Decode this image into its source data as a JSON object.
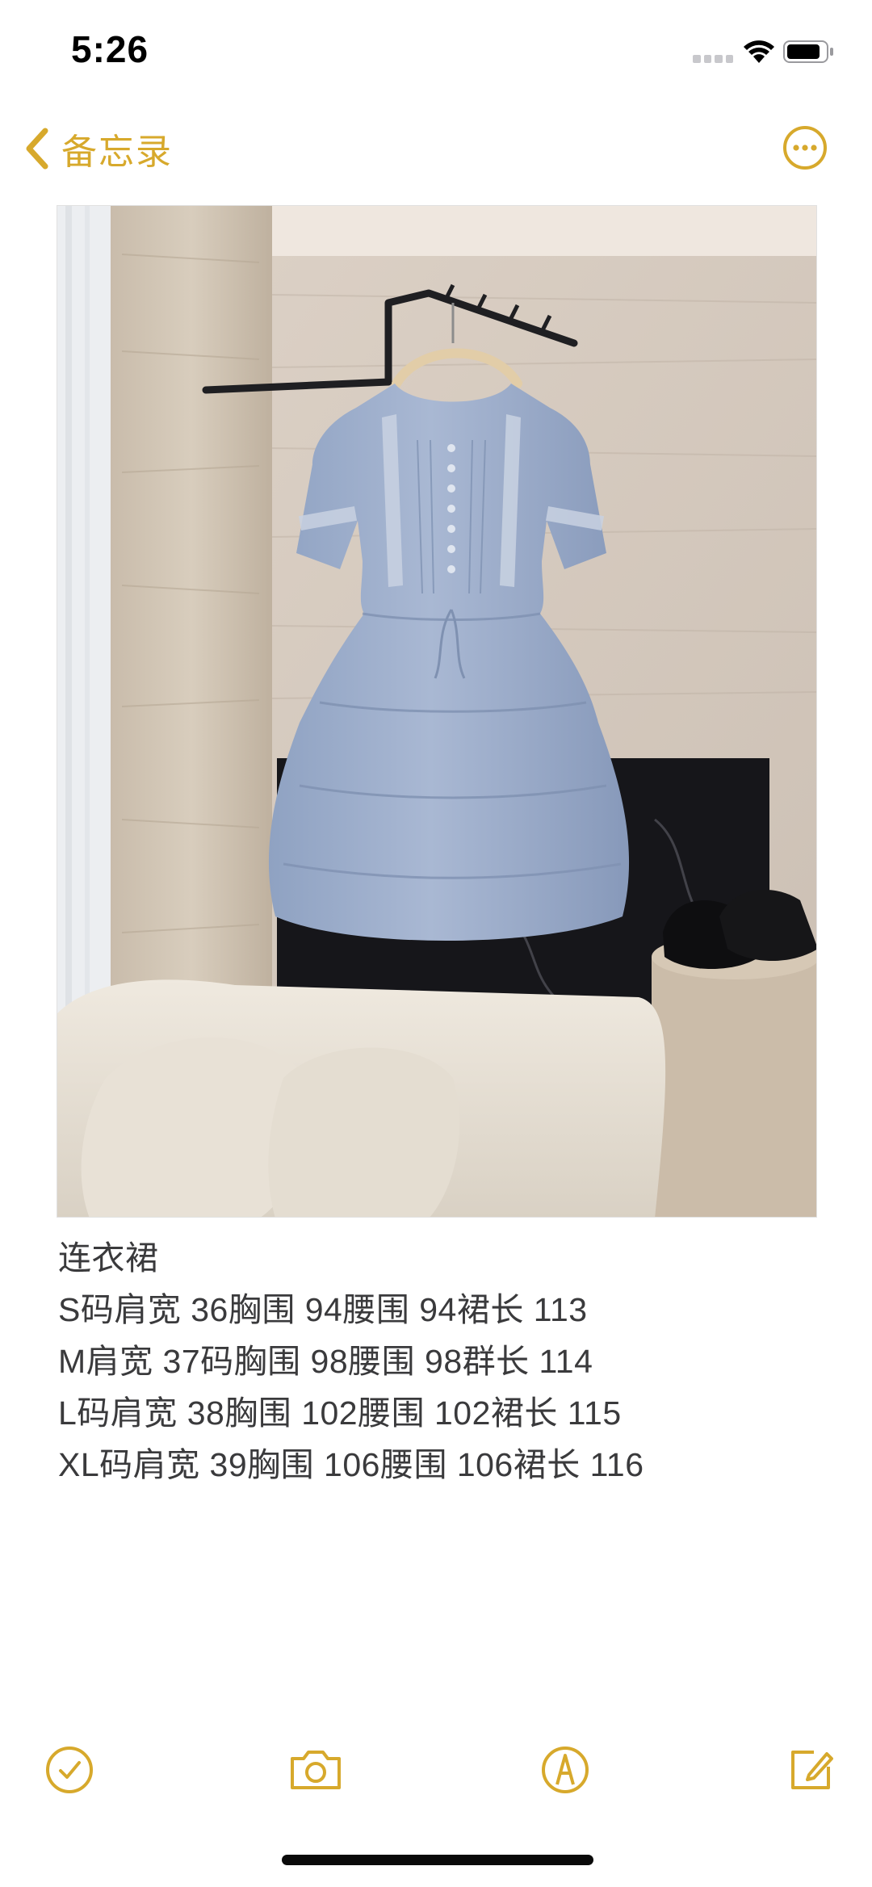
{
  "status_bar": {
    "time": "5:26"
  },
  "nav": {
    "back_label": "备忘录",
    "icons": {
      "back": "chevron-left-icon",
      "more": "ellipsis-circle-icon"
    }
  },
  "note": {
    "title": "连衣裙",
    "lines": [
      "S码肩宽 36胸围 94腰围 94裙长 113",
      "M肩宽 37码胸围 98腰围 98群长 114",
      "L码肩宽 38胸围 102腰围 102裙长 115",
      "XL码肩宽 39胸围 106腰围 106裙长 116"
    ]
  },
  "toolbar": {
    "icons": [
      "checklist-icon",
      "camera-icon",
      "markup-pen-icon",
      "compose-icon"
    ]
  },
  "colors": {
    "accent": "#d7a92c",
    "text": "#3a3a3c"
  }
}
